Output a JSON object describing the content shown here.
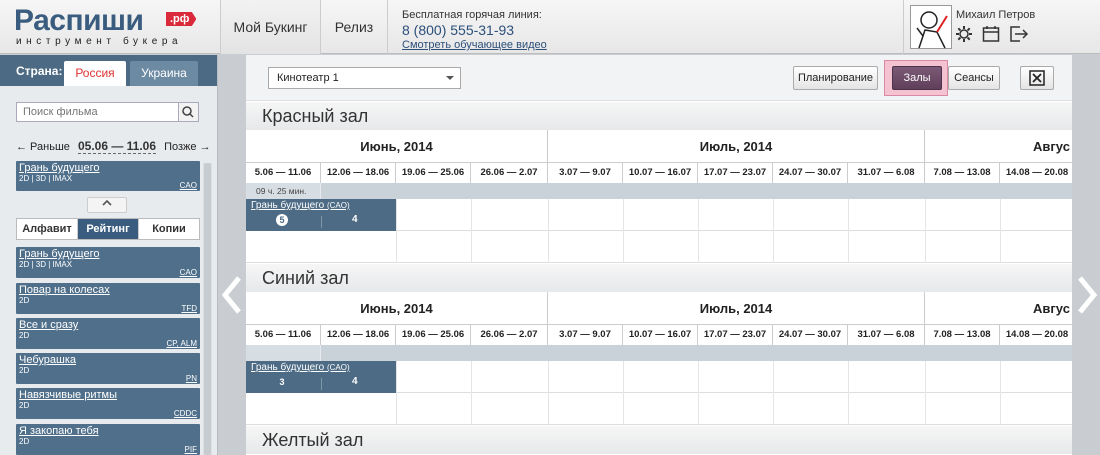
{
  "header": {
    "logo_main": "Распиши",
    "logo_badge": ".рф",
    "logo_sub": "инструмент букера",
    "nav_tabs": [
      "Мой Букинг",
      "Релиз"
    ],
    "hotline_label": "Бесплатная горячая линия:",
    "hotline_number": "8 (800) 555-31-93",
    "video_link": "Смотреть обучающее видео",
    "user_name": "Михаил Петров",
    "icons": [
      "settings-icon",
      "calendar-icon",
      "logout-icon"
    ]
  },
  "sidebar": {
    "country_label": "Страна:",
    "countries": [
      "Россия",
      "Украина"
    ],
    "search_placeholder": "Поиск фильма",
    "period_prev": "← Раньше",
    "period_dates": "05.06 — 11.06",
    "period_next": "Позже →",
    "selected_film": {
      "title": "Грань будущего",
      "formats": "2D | 3D | IMAX",
      "distributor": "CAO"
    },
    "sort_tabs": [
      "Алфавит",
      "Рейтинг",
      "Копии"
    ],
    "active_sort": "Рейтинг",
    "films": [
      {
        "title": "Грань будущего",
        "formats": "2D | 3D | IMAX",
        "distributor": "CAO"
      },
      {
        "title": "Повар на колесах",
        "formats": "2D",
        "distributor": "TFD"
      },
      {
        "title": "Все и сразу",
        "formats": "2D",
        "distributor": "CP, ALM"
      },
      {
        "title": "Чебурашка",
        "formats": "2D",
        "distributor": "PN"
      },
      {
        "title": "Навязчивые ритмы",
        "formats": "2D",
        "distributor": "CDDC"
      },
      {
        "title": "Я закопаю тебя",
        "formats": "2D",
        "distributor": "PIF"
      }
    ]
  },
  "toolbar": {
    "cinema": "Кинотеатр 1",
    "btn_planning": "Планирование",
    "btn_halls": "Залы",
    "btn_sessions": "Сеансы"
  },
  "months": [
    "Июнь, 2014",
    "Июль, 2014",
    "Авгус"
  ],
  "weeks": [
    "5.06 — 11.06",
    "12.06 — 18.06",
    "19.06 — 25.06",
    "26.06 — 2.07",
    "3.07 — 9.07",
    "10.07 — 16.07",
    "17.07 — 23.07",
    "24.07 — 30.07",
    "31.07 — 6.08",
    "7.08 — 13.08",
    "14.08 — 20.08"
  ],
  "halls": [
    {
      "name": "Красный зал",
      "duration": "09 ч. 25 мин.",
      "booking": {
        "title": "Грань будущего",
        "distributor": "(CAO)",
        "week1": "5",
        "week2": "4"
      }
    },
    {
      "name": "Синий зал",
      "duration": "",
      "booking": {
        "title": "Грань будущего",
        "distributor": "(CAO)",
        "week1": "3",
        "week2": "4"
      }
    },
    {
      "name": "Желтый зал"
    }
  ]
}
